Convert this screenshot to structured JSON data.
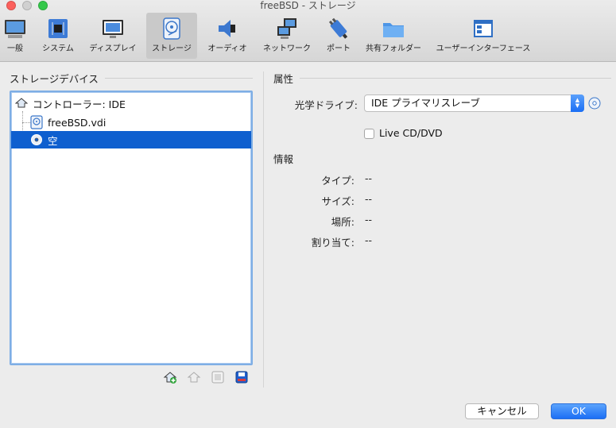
{
  "window": {
    "title": "freeBSD - ストレージ"
  },
  "toolbar": {
    "items": [
      {
        "label": "一般",
        "icon": "monitor-icon"
      },
      {
        "label": "システム",
        "icon": "chip-icon"
      },
      {
        "label": "ディスプレイ",
        "icon": "display-icon"
      },
      {
        "label": "ストレージ",
        "icon": "harddisk-icon",
        "active": true
      },
      {
        "label": "オーディオ",
        "icon": "speaker-icon"
      },
      {
        "label": "ネットワーク",
        "icon": "network-icon"
      },
      {
        "label": "ポート",
        "icon": "plug-icon"
      },
      {
        "label": "共有フォルダー",
        "icon": "folder-icon"
      },
      {
        "label": "ユーザーインターフェース",
        "icon": "window-ui-icon"
      }
    ]
  },
  "storage": {
    "header": "ストレージデバイス",
    "tree": [
      {
        "label": "コントローラー: IDE",
        "type": "controller",
        "icon": "ide-controller-icon"
      },
      {
        "label": "freeBSD.vdi",
        "type": "disk",
        "icon": "hard-disk-icon"
      },
      {
        "label": "空",
        "type": "optical",
        "icon": "optical-disc-icon",
        "selected": true
      }
    ],
    "tools": [
      "add-attachment-icon",
      "remove-attachment-icon",
      "add-controller-icon",
      "remove-controller-icon"
    ]
  },
  "attributes": {
    "header": "属性",
    "optical_drive_label": "光学ドライブ:",
    "optical_drive_value": "IDE プライマリスレーブ",
    "live_cd_label": "Live CD/DVD",
    "live_cd_checked": false
  },
  "info": {
    "header": "情報",
    "rows": [
      {
        "label": "タイプ:",
        "value": "--"
      },
      {
        "label": "サイズ:",
        "value": "--"
      },
      {
        "label": "場所:",
        "value": "--"
      },
      {
        "label": "割り当て:",
        "value": "--"
      }
    ]
  },
  "buttons": {
    "cancel": "キャンセル",
    "ok": "OK"
  },
  "colors": {
    "selection": "#0e5fcf",
    "accent": "#1c6ff5"
  }
}
